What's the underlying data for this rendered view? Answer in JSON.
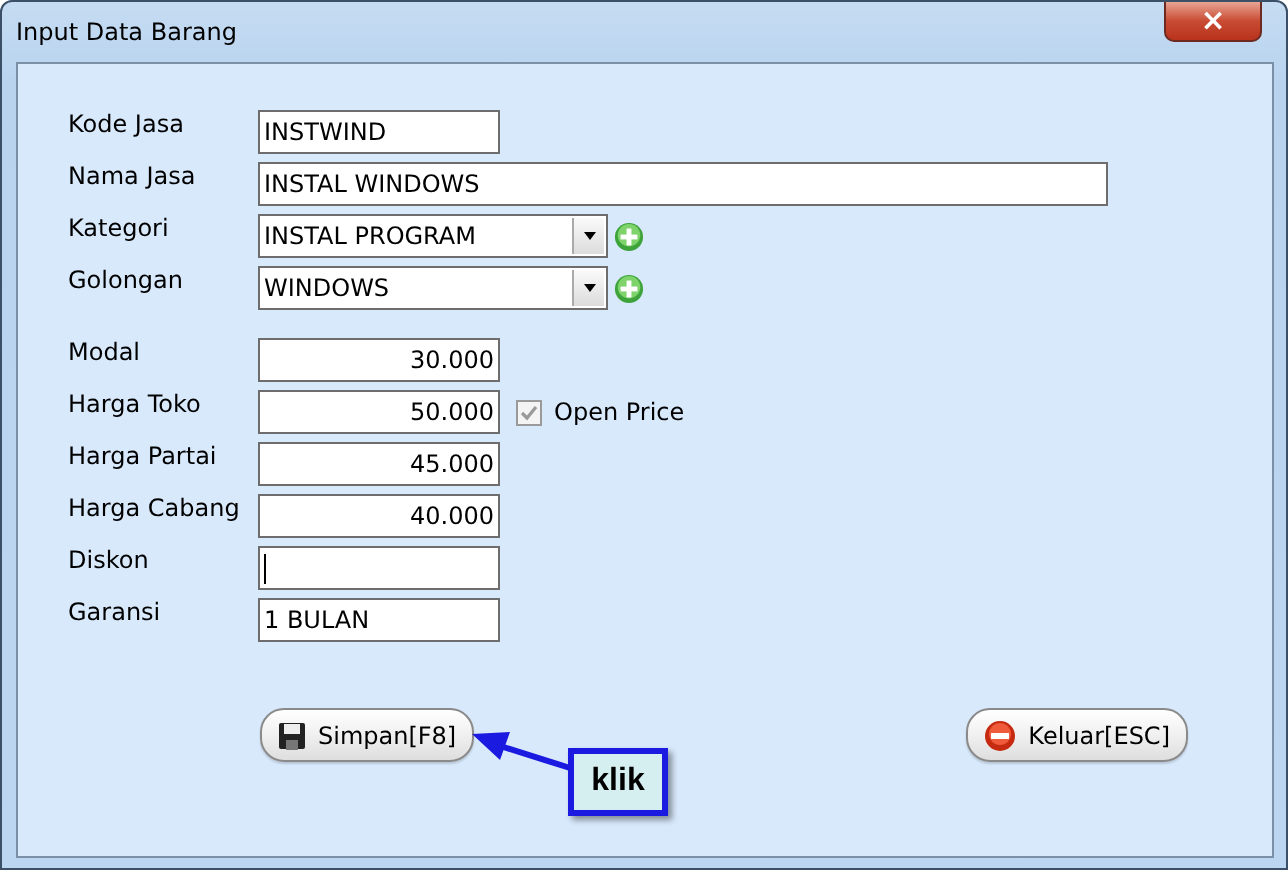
{
  "window": {
    "title": "Input Data Barang",
    "close": "×"
  },
  "field_groups": [
    [
      {
        "label": "Kode Jasa",
        "kind": "text",
        "value": "INSTWIND"
      },
      {
        "label": "Nama Jasa",
        "kind": "text",
        "value": "INSTAL WINDOWS"
      },
      {
        "label": "Kategori",
        "kind": "combo",
        "value": "INSTAL PROGRAM"
      },
      {
        "label": "Golongan",
        "kind": "combo",
        "value": "WINDOWS"
      }
    ],
    [
      {
        "label": "Modal",
        "kind": "number",
        "value": "30.000"
      },
      {
        "label": "Harga Toko",
        "kind": "number",
        "value": "50.000",
        "checkbox": {
          "label": "Open Price",
          "checked": true,
          "disabled": true
        }
      },
      {
        "label": "Harga Partai",
        "kind": "number",
        "value": "45.000"
      },
      {
        "label": "Harga Cabang",
        "kind": "number",
        "value": "40.000"
      },
      {
        "label": "Diskon",
        "kind": "text",
        "focused": true
      },
      {
        "label": "Garansi",
        "kind": "text",
        "value": "1 BULAN"
      }
    ]
  ],
  "buttons": [
    {
      "label": "Simpan[F8]",
      "kind": "save"
    },
    {
      "label": "Keluar[ESC]",
      "kind": "exit"
    }
  ],
  "callout": {
    "text": "klik"
  }
}
